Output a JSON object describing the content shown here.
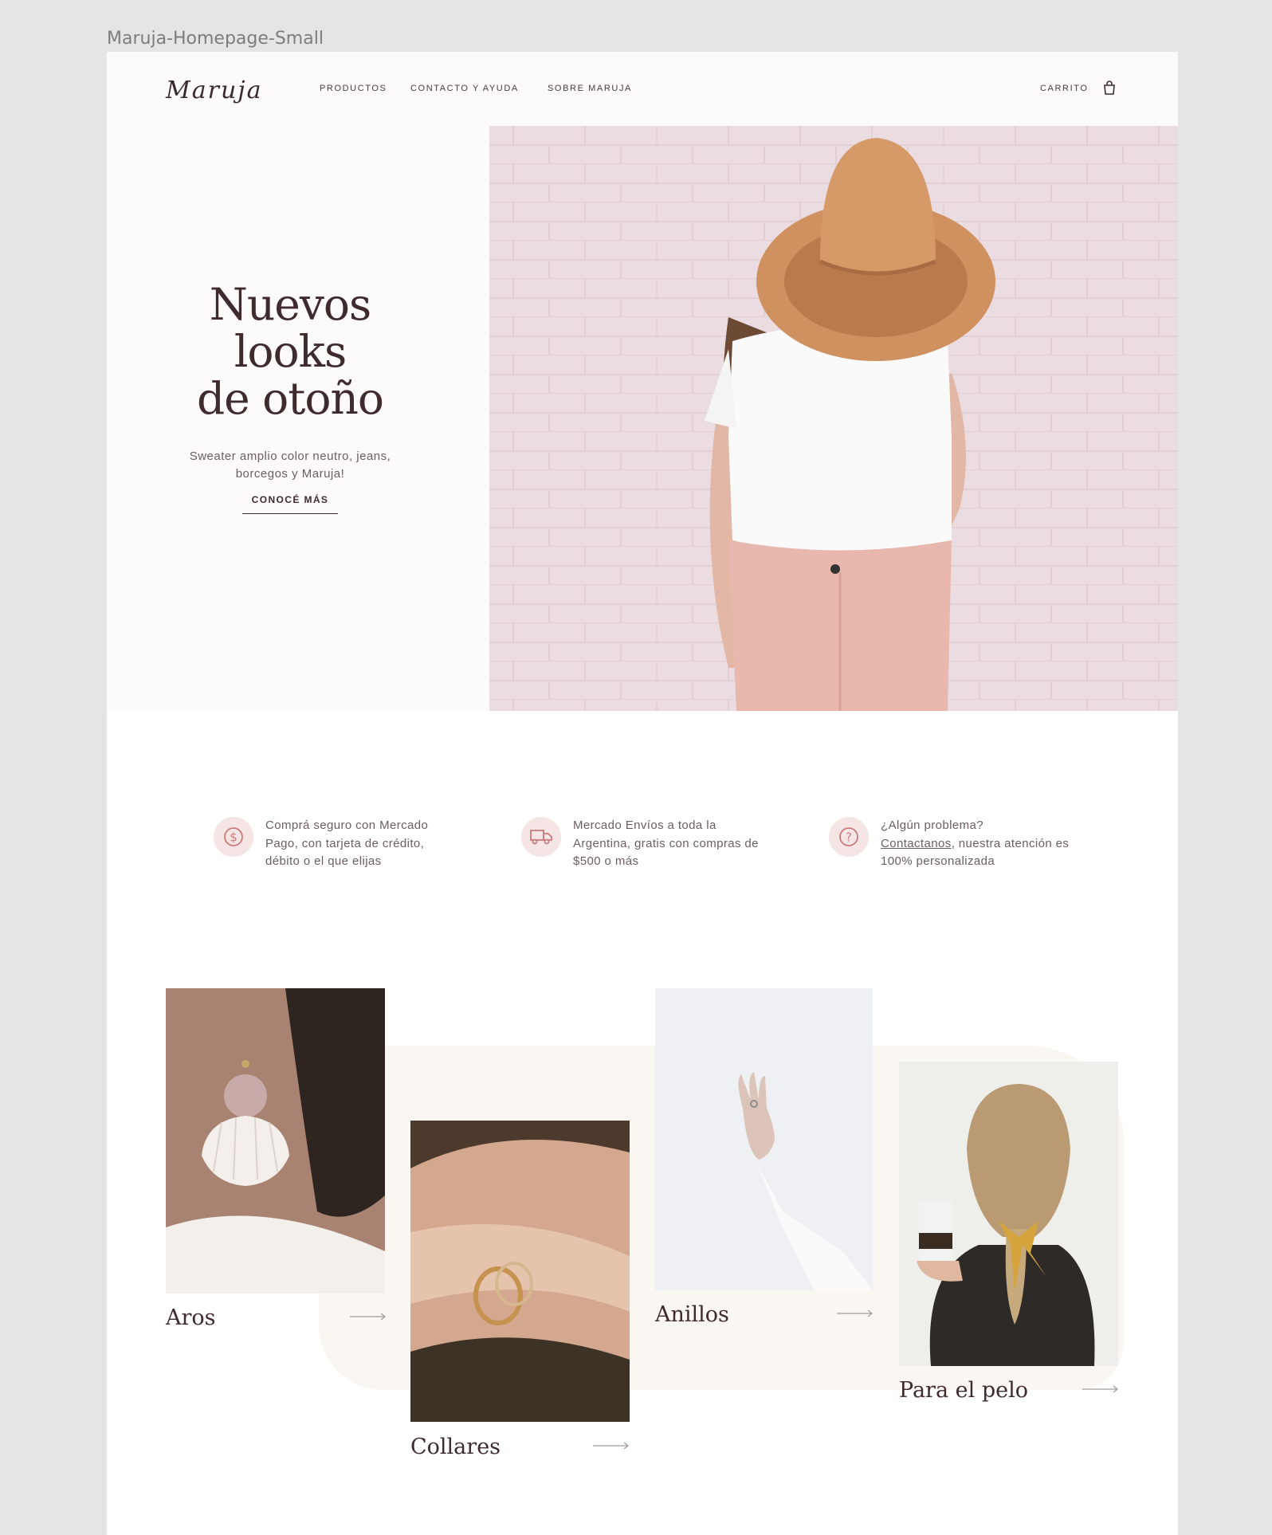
{
  "frame_label": "Maruja-Homepage-Small",
  "header": {
    "logo": "Maruja",
    "nav": [
      "PRODUCTOS",
      "CONTACTO Y AYUDA",
      "SOBRE MARUJA"
    ],
    "cart_label": "CARRITO",
    "cart_icon": "shopping-bag-icon"
  },
  "hero": {
    "title_lines": [
      "Nuevos",
      "looks",
      "de otoño"
    ],
    "subtitle": "Sweater amplio color neutro, jeans, borcegos y Maruja!",
    "cta": "CONOCÉ MÁS"
  },
  "features": [
    {
      "icon": "dollar-icon",
      "text": "Comprá seguro con Mercado Pago, con tarjeta de crédito, débito o el que elijas"
    },
    {
      "icon": "truck-icon",
      "text": "Mercado Envíos a toda la Argentina, gratis con compras de $500 o más"
    },
    {
      "icon": "question-icon",
      "text_before": "¿Algún problema?",
      "link": "Contactanos",
      "text_after": ", nuestra atención es 100% personalizada"
    }
  ],
  "categories": [
    "Aros",
    "Collares",
    "Anillos",
    "Para el pelo"
  ],
  "colors": {
    "background": "#e5e5e5",
    "header": "#fcfafa",
    "text_dark": "#3f2a2d",
    "icon_circle": "#f6e5e5",
    "icon_stroke": "#c97b7b",
    "blob": "#faf6f2"
  }
}
